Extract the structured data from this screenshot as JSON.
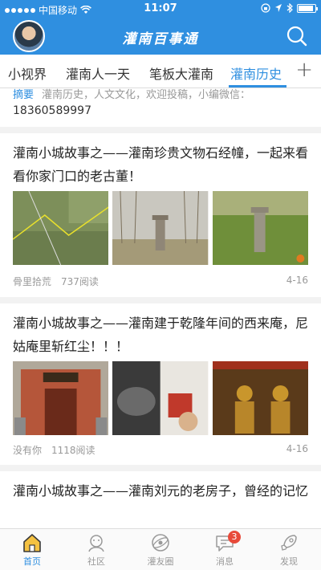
{
  "status_bar": {
    "carrier": "中国移动",
    "time": "11:07"
  },
  "header": {
    "title": "灌南百事通"
  },
  "tabs": [
    {
      "label": "小视界"
    },
    {
      "label": "灌南人一天"
    },
    {
      "label": "笔板大灌南"
    },
    {
      "label": "灌南历史",
      "active": true
    }
  ],
  "summary": {
    "tag": "摘要",
    "text": "灌南历史，人文文化，欢迎投稿，小编微信：",
    "wechat": "18360589997"
  },
  "articles": [
    {
      "title": "灌南小城故事之——灌南珍贵文物石经幢，一起来看看你家门口的老古董！",
      "author": "骨里拾荒",
      "reads": "737阅读",
      "date": "4-16"
    },
    {
      "title": "灌南小城故事之——灌南建于乾隆年间的西来庵，尼姑庵里斩红尘！！！",
      "author": "没有你",
      "reads": "1118阅读",
      "date": "4-16"
    },
    {
      "title": "灌南小城故事之——灌南刘元的老房子，曾经的记忆"
    }
  ],
  "tabbar": [
    {
      "label": "首页",
      "icon": "home-icon",
      "active": true
    },
    {
      "label": "社区",
      "icon": "community-icon"
    },
    {
      "label": "灌友圈",
      "icon": "circle-icon"
    },
    {
      "label": "消息",
      "icon": "message-icon",
      "badge": "3"
    },
    {
      "label": "发现",
      "icon": "rocket-icon"
    }
  ],
  "colors": {
    "accent": "#2f8fe0",
    "badge": "#e84a3a"
  }
}
